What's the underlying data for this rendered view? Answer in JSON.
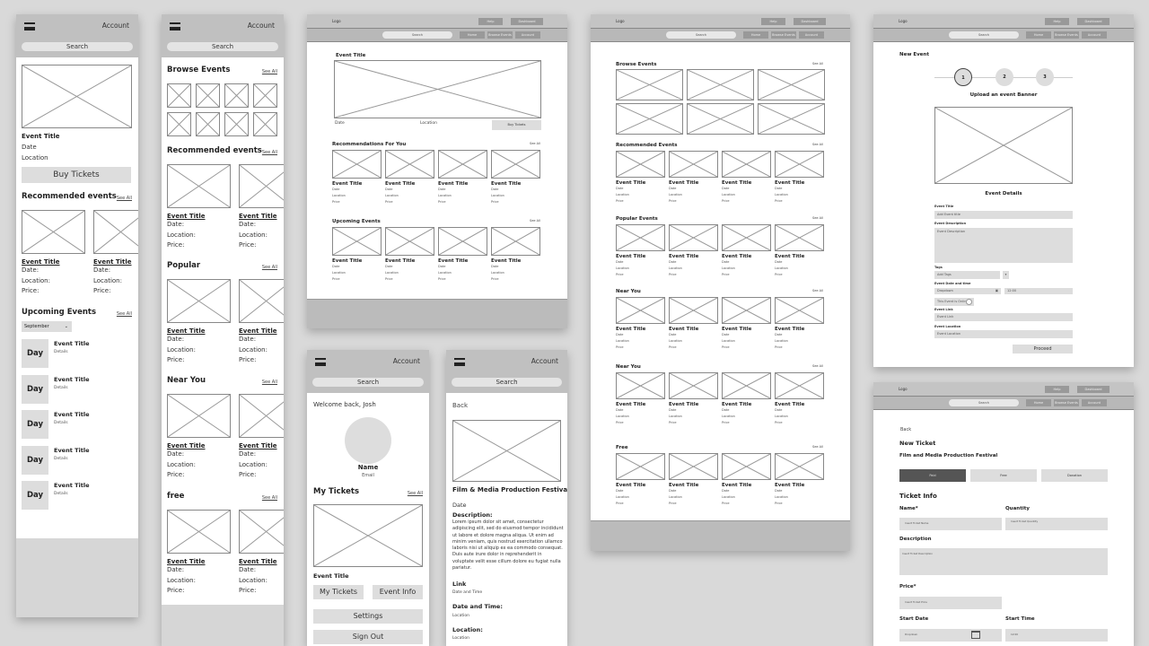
{
  "mobile_header": {
    "menu_icon": "hamburger-icon",
    "account": "Account",
    "search": "Search"
  },
  "desktop_header": {
    "logo": "Logo",
    "help": "Help",
    "dashboard": "Dashboard",
    "search": "Search",
    "home": "Home",
    "browse_events": "Browse Events",
    "account": "Account"
  },
  "screen1": {
    "featured": {
      "title": "Event Title",
      "date": "Date",
      "location": "Location",
      "buy": "Buy Tickets"
    },
    "recommended": {
      "heading": "Recommended events",
      "see_all": "See All",
      "cards": [
        {
          "title": "Event Title",
          "date": "Date:",
          "location": "Location:",
          "price": "Price:"
        },
        {
          "title": "Event Title",
          "date": "Date:",
          "location": "Location:",
          "price": "Price:"
        }
      ]
    },
    "upcoming": {
      "heading": "Upcoming Events",
      "see_all": "See All",
      "month": "September",
      "items": [
        {
          "day": "Day",
          "title": "Event Title",
          "details": "Details"
        },
        {
          "day": "Day",
          "title": "Event Title",
          "details": "Details"
        },
        {
          "day": "Day",
          "title": "Event Title",
          "details": "Details"
        },
        {
          "day": "Day",
          "title": "Event Title",
          "details": "Details"
        },
        {
          "day": "Day",
          "title": "Event Title",
          "details": "Details"
        }
      ]
    }
  },
  "screen2": {
    "browse": {
      "heading": "Browse Events",
      "see_all": "See All"
    },
    "sections": [
      {
        "heading": "Recommended events",
        "see_all": "See All"
      },
      {
        "heading": "Popular",
        "see_all": "See All"
      },
      {
        "heading": "Near You",
        "see_all": "See All"
      },
      {
        "heading": "free",
        "see_all": "See All"
      }
    ],
    "card": {
      "title": "Event Title",
      "date": "Date:",
      "location": "Location:",
      "price": "Price:"
    }
  },
  "screen3": {
    "featured": {
      "title": "Event Title",
      "date": "Date",
      "location": "Location",
      "buy": "Buy Tickets"
    },
    "sections": [
      {
        "heading": "Recommendations For You",
        "see_all": "See All"
      },
      {
        "heading": "Upcoming Events",
        "see_all": "See All"
      }
    ],
    "card": {
      "title": "Event Title",
      "date": "Date",
      "location": "Location",
      "price": "Price"
    }
  },
  "screen4": {
    "welcome": "Welcome back, Josh",
    "name": "Name",
    "email": "Email",
    "my_tickets": {
      "heading": "My Tickets",
      "see_all": "See All",
      "event_title": "Event Title"
    },
    "buttons": {
      "my_tickets": "My Tickets",
      "event_info": "Event Info",
      "settings": "Settings",
      "sign_out": "Sign Out"
    }
  },
  "screen5": {
    "back": "Back",
    "title": "Film & Media Production Festival",
    "date": "Date",
    "description_label": "Description:",
    "description": "Lorem ipsum dolor sit amet, consectetur adipiscing elit, sed do eiusmod tempor incididunt ut labore et dolore magna aliqua. Ut enim ad minim veniam, quis nostrud exercitation ullamco laboris nisi ut aliquip ex ea commodo consequat. Duis aute irure dolor in reprehenderit in voluptate velit esse cillum dolore eu fugiat nulla pariatur.",
    "link_label": "Link",
    "link_value": "Date and Time",
    "datetime_label": "Date and Time:",
    "datetime_value": "Location",
    "location_label": "Location:",
    "location_value": "Location"
  },
  "screen6": {
    "sections": [
      {
        "heading": "Browse Events",
        "see_all": "See All"
      },
      {
        "heading": "Recommended Events",
        "see_all": "See All"
      },
      {
        "heading": "Popular Events",
        "see_all": "See All"
      },
      {
        "heading": "Near You",
        "see_all": "See All"
      },
      {
        "heading": "Near You",
        "see_all": "See All"
      },
      {
        "heading": "Free",
        "see_all": "See All"
      }
    ],
    "card": {
      "title": "Event Title",
      "date": "Date",
      "location": "Location",
      "price": "Price"
    }
  },
  "screen7": {
    "heading": "New Event",
    "steps": [
      "1",
      "2",
      "3"
    ],
    "upload": "Upload an event Banner",
    "details": "Event Details",
    "fields": {
      "title_label": "Event Title",
      "title_ph": "Add Event title",
      "desc_label": "Event Description",
      "desc_ph": "Event Description",
      "tags_label": "Tags",
      "tags_ph": "Add Tags",
      "dt_label": "Event Date and time",
      "date_ph": "Dropdown",
      "time_ph": "12:00",
      "online": "This Event is Online",
      "link_label": "Event Link",
      "link_ph": "Event Link",
      "loc_label": "Event Location",
      "loc_ph": "Event Location"
    },
    "proceed": "Proceed"
  },
  "screen8": {
    "back": "Back",
    "heading": "New Ticket",
    "event": "Film and Media Production Festival",
    "types": [
      "Paid",
      "Free",
      "Donation"
    ],
    "selected_type": "Paid",
    "info": "Ticket Info",
    "name_label": "Name*",
    "name_ph": "Insert Ticket Name",
    "qty_label": "Quantity",
    "qty_ph": "Insert Ticket Quantity",
    "desc_label": "Description",
    "desc_ph": "Insert Ticket Description",
    "price_label": "Price*",
    "price_ph": "Insert Ticket Price",
    "start_date_label": "Start Date",
    "start_date_ph": "Dropdown",
    "start_time_label": "Start Time",
    "start_time_ph": "12:00"
  }
}
